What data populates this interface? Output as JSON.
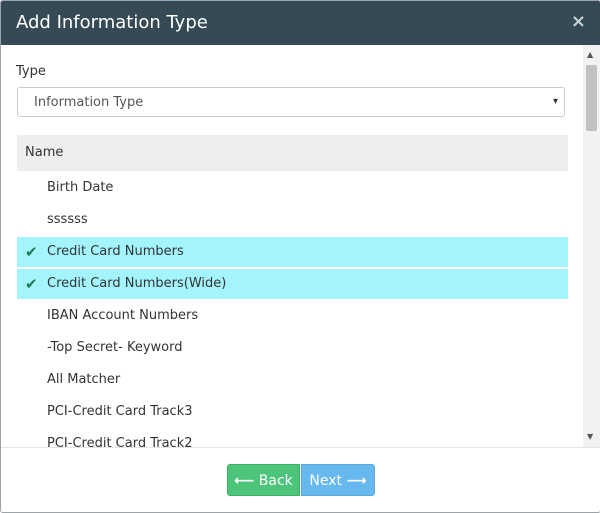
{
  "dialog": {
    "title": "Add Information Type",
    "close_icon": "×"
  },
  "form": {
    "type_label": "Type",
    "type_select": {
      "value": "Information Type",
      "caret": "▾"
    }
  },
  "table": {
    "header": "Name",
    "rows": [
      {
        "label": "Birth Date",
        "selected": false
      },
      {
        "label": "ssssss",
        "selected": false
      },
      {
        "label": "Credit Card Numbers",
        "selected": true
      },
      {
        "label": "Credit Card Numbers(Wide)",
        "selected": true
      },
      {
        "label": "IBAN Account Numbers",
        "selected": false
      },
      {
        "label": "-Top Secret- Keyword",
        "selected": false
      },
      {
        "label": "All Matcher",
        "selected": false
      },
      {
        "label": "PCI-Credit Card Track3",
        "selected": false
      },
      {
        "label": "PCI-Credit Card Track2",
        "selected": false
      }
    ],
    "check_glyph": "✔"
  },
  "footer": {
    "back_label": "Back",
    "next_label": "Next",
    "back_arrow": "⟵",
    "next_arrow": "⟶"
  },
  "colors": {
    "header_bg": "#354a54",
    "selected_row": "#a3f4fd",
    "check": "#1e7d49",
    "back_button": "#4cc47a",
    "next_button": "#66b8ee"
  }
}
